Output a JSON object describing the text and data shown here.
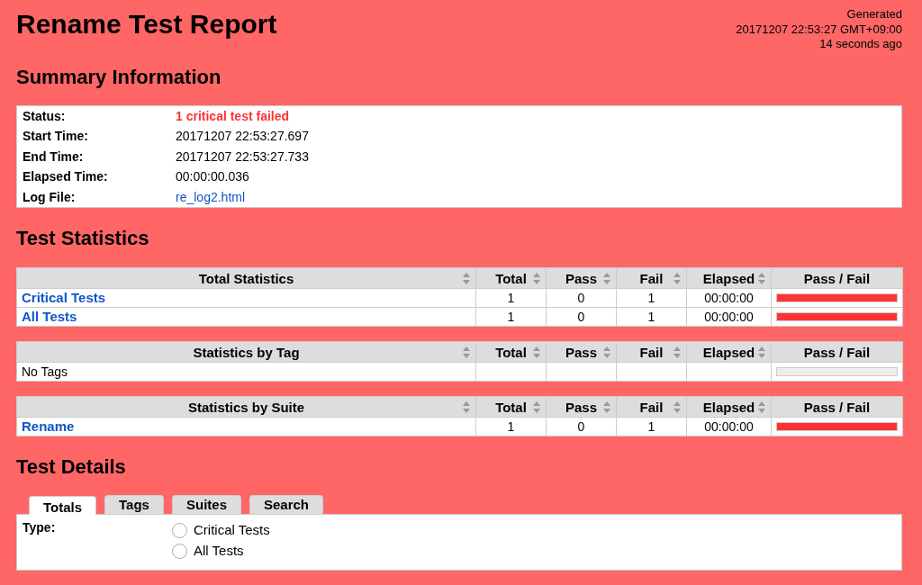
{
  "header": {
    "title": "Rename Test Report",
    "generated": [
      "Generated",
      "20171207 22:53:27 GMT+09:00",
      "14 seconds ago"
    ]
  },
  "summary": {
    "heading": "Summary Information",
    "rows": [
      {
        "label": "Status:",
        "value": "1 critical test failed",
        "kind": "status"
      },
      {
        "label": "Start Time:",
        "value": "20171207 22:53:27.697",
        "kind": "text"
      },
      {
        "label": "End Time:",
        "value": "20171207 22:53:27.733",
        "kind": "text"
      },
      {
        "label": "Elapsed Time:",
        "value": "00:00:00.036",
        "kind": "text"
      },
      {
        "label": "Log File:",
        "value": "re_log2.html",
        "kind": "link"
      }
    ]
  },
  "statistics": {
    "heading": "Test Statistics",
    "tables": [
      {
        "columns": [
          {
            "label": "Total Statistics",
            "sortable": true
          },
          {
            "label": "Total",
            "sortable": true
          },
          {
            "label": "Pass",
            "sortable": true
          },
          {
            "label": "Fail",
            "sortable": true
          },
          {
            "label": "Elapsed",
            "sortable": true
          },
          {
            "label": "Pass / Fail",
            "sortable": false
          }
        ],
        "rows": [
          {
            "kind": "link",
            "cells": [
              "Critical Tests",
              "1",
              "0",
              "1",
              "00:00:00"
            ],
            "level": 1
          },
          {
            "kind": "link",
            "cells": [
              "All Tests",
              "1",
              "0",
              "1",
              "00:00:00"
            ],
            "level": 1
          }
        ]
      },
      {
        "columns": [
          {
            "label": "Statistics by Tag",
            "sortable": true
          },
          {
            "label": "Total",
            "sortable": true
          },
          {
            "label": "Pass",
            "sortable": true
          },
          {
            "label": "Fail",
            "sortable": true
          },
          {
            "label": "Elapsed",
            "sortable": true
          },
          {
            "label": "Pass / Fail",
            "sortable": false
          }
        ],
        "rows": [
          {
            "kind": "text",
            "cells": [
              "No Tags"
            ],
            "level": 0
          }
        ]
      },
      {
        "columns": [
          {
            "label": "Statistics by Suite",
            "sortable": true
          },
          {
            "label": "Total",
            "sortable": true
          },
          {
            "label": "Pass",
            "sortable": true
          },
          {
            "label": "Fail",
            "sortable": true
          },
          {
            "label": "Elapsed",
            "sortable": true
          },
          {
            "label": "Pass / Fail",
            "sortable": false
          }
        ],
        "rows": [
          {
            "kind": "link",
            "cells": [
              "Rename",
              "1",
              "0",
              "1",
              "00:00:00"
            ],
            "level": 1
          }
        ]
      }
    ]
  },
  "details": {
    "heading": "Test Details",
    "tabs": [
      {
        "label": "Totals",
        "selected": true
      },
      {
        "label": "Tags",
        "selected": false
      },
      {
        "label": "Suites",
        "selected": false
      },
      {
        "label": "Search",
        "selected": false
      }
    ],
    "type_label": "Type:",
    "options": [
      {
        "label": "Critical Tests",
        "checked": false
      },
      {
        "label": "All Tests",
        "checked": false
      }
    ]
  }
}
